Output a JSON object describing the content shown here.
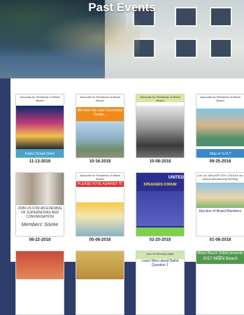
{
  "page": {
    "title": "Past Events"
  },
  "events": [
    {
      "date": "11-13-2018",
      "caption": "Iconic Ocean Drive",
      "header": "Advocate for Residents of Miami Beach"
    },
    {
      "date": "10-16-2018",
      "caption": "We have the new Convention Center...",
      "header": "Advocate for Residents of Miami Beach"
    },
    {
      "date": "10-08-2018",
      "caption": "",
      "header": "Advocate for Residents of Miami Beach"
    },
    {
      "date": "09-25-2018",
      "caption": "Stop or G.O.?",
      "header": "Advocate for Residents of Miami Beach"
    },
    {
      "date": "08-22-2018",
      "caption": "Members' Soirée",
      "header": "JOIN US FOR AN EVENING OF SUPERNOVAS AND CONVERSATION"
    },
    {
      "date": "05-08-2018",
      "caption": "PLEASE VOTE AGAINST IT!",
      "header": "Advocate for Residents of Miami Beach"
    },
    {
      "date": "02-20-2018",
      "caption": "SPEAKERS FORUM",
      "header": "UNITED"
    },
    {
      "date": "01-08-2018",
      "caption": "Election of Board Members",
      "header": "Join Us JANUARY 8TH, 2018 for our annual Membership Meeting"
    },
    {
      "date": "",
      "caption": "",
      "header": ""
    },
    {
      "date": "",
      "caption": "",
      "header": ""
    },
    {
      "date": "",
      "caption": "Join Us Monday Night",
      "header": "Learn More about Ballot Question 1"
    },
    {
      "date": "",
      "caption": "2017 Miami Beach",
      "header": "Miami Beach United presents the"
    }
  ],
  "colors": {
    "hero_bg": "#2f3d6a",
    "panel_bg": "#ffffff"
  }
}
